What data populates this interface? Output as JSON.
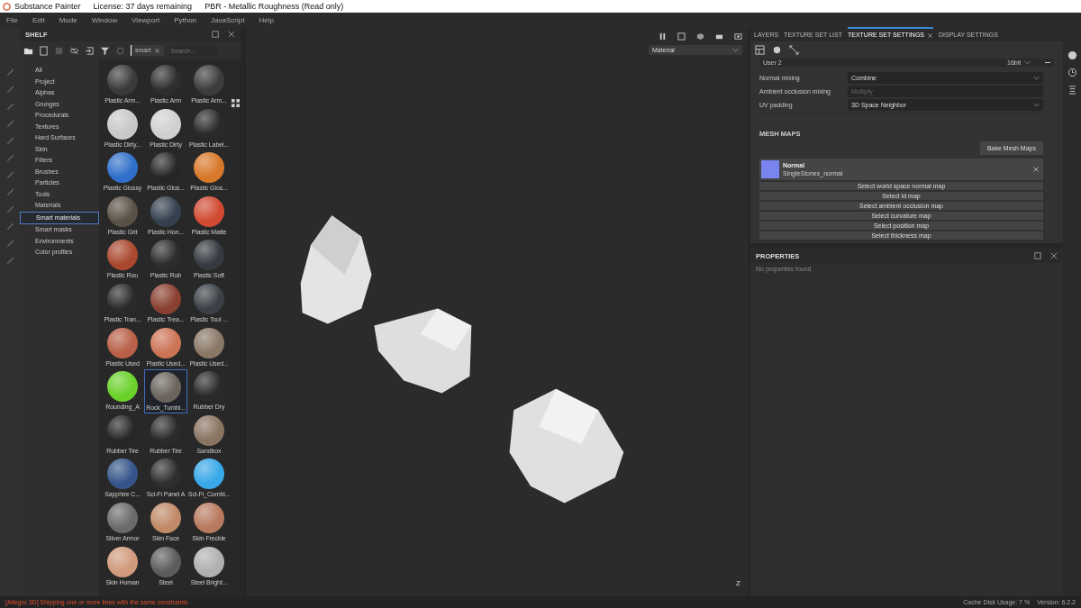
{
  "window": {
    "title": "Substance Painter",
    "license": "License: 37 days remaining",
    "mode": "PBR - Metallic Roughness (Read only)"
  },
  "menu": [
    "File",
    "Edit",
    "Mode",
    "Window",
    "Viewport",
    "Python",
    "JavaScript",
    "Help"
  ],
  "shelf": {
    "title": "SHELF",
    "filter_tag": "smart",
    "search": {
      "placeholder": "Search..."
    },
    "categories": [
      {
        "label": "All",
        "selected": false
      },
      {
        "label": "Project",
        "selected": false
      },
      {
        "label": "Alphas",
        "selected": false
      },
      {
        "label": "Grunges",
        "selected": false
      },
      {
        "label": "Procedurals",
        "selected": false
      },
      {
        "label": "Textures",
        "selected": false
      },
      {
        "label": "Hard Surfaces",
        "selected": false
      },
      {
        "label": "Skin",
        "selected": false
      },
      {
        "label": "Filters",
        "selected": false
      },
      {
        "label": "Brushes",
        "selected": false
      },
      {
        "label": "Particles",
        "selected": false
      },
      {
        "label": "Tools",
        "selected": false
      },
      {
        "label": "Materials",
        "selected": false
      },
      {
        "label": "Smart materials",
        "selected": true
      },
      {
        "label": "Smart masks",
        "selected": false
      },
      {
        "label": "Environments",
        "selected": false
      },
      {
        "label": "Color profiles",
        "selected": false
      }
    ],
    "materials": [
      {
        "name": "Plastic Arm...",
        "color": "#3a3a3a",
        "selected": false
      },
      {
        "name": "Plastic Arm",
        "color": "#2e2e2e",
        "selected": false
      },
      {
        "name": "Plastic Arm...",
        "color": "#3c3c3c",
        "selected": false
      },
      {
        "name": "Plastic Dirty...",
        "color": "#c8c8c8",
        "selected": false
      },
      {
        "name": "Plastic Dirty",
        "color": "#d0d0d0",
        "selected": false
      },
      {
        "name": "Plastic Label...",
        "color": "#2a2a2a",
        "selected": false
      },
      {
        "name": "Plastic Glossy",
        "color": "#2f6fc9",
        "selected": false
      },
      {
        "name": "Plastic Glos...",
        "color": "#262626",
        "selected": false
      },
      {
        "name": "Plastic Glos...",
        "color": "#d8782a",
        "selected": false
      },
      {
        "name": "Plastic Grit",
        "color": "#5a5146",
        "selected": false
      },
      {
        "name": "Plastic Hon...",
        "color": "#34404e",
        "selected": false
      },
      {
        "name": "Plastic Matte",
        "color": "#d24a32",
        "selected": false
      },
      {
        "name": "Plastic Rou",
        "color": "#a9482f",
        "selected": false
      },
      {
        "name": "Plastic Rub",
        "color": "#2c2c2c",
        "selected": false
      },
      {
        "name": "Plastic Soft",
        "color": "#343a40",
        "selected": false
      },
      {
        "name": "Plastic Tran...",
        "color": "#2a2a2a",
        "selected": false
      },
      {
        "name": "Plastic Trea...",
        "color": "#8a4030",
        "selected": false
      },
      {
        "name": "Plastic Tool ...",
        "color": "#3a4046",
        "selected": false
      },
      {
        "name": "Plastic Used",
        "color": "#b86048",
        "selected": false
      },
      {
        "name": "Plastic Used...",
        "color": "#cc7456",
        "selected": false
      },
      {
        "name": "Plastic Used...",
        "color": "#8a7866",
        "selected": false
      },
      {
        "name": "Rounding_A",
        "color": "#6ad12a",
        "selected": false
      },
      {
        "name": "Rock_Tumbl...",
        "color": "#6a645c",
        "selected": true
      },
      {
        "name": "Rubber Dry",
        "color": "#2a2a2a",
        "selected": false
      },
      {
        "name": "Rubber Tire",
        "color": "#262626",
        "selected": false
      },
      {
        "name": "Rubber Tire",
        "color": "#2a2a2a",
        "selected": false
      },
      {
        "name": "Sandbox",
        "color": "#8a7462",
        "selected": false
      },
      {
        "name": "Sapphire C...",
        "color": "#35558a",
        "selected": false
      },
      {
        "name": "Sci-Fi Panel A",
        "color": "#2e2e2e",
        "selected": false
      },
      {
        "name": "Sci-Fi_Combi...",
        "color": "#38a8e8",
        "selected": false
      },
      {
        "name": "Silver Armor",
        "color": "#6a6a6a",
        "selected": false
      },
      {
        "name": "Skin Face",
        "color": "#c08a68",
        "selected": false
      },
      {
        "name": "Skin Freckle",
        "color": "#b87a5e",
        "selected": false
      },
      {
        "name": "Skin Human",
        "color": "#d09a7c",
        "selected": false
      },
      {
        "name": "Steel",
        "color": "#5c5c5c",
        "selected": false
      },
      {
        "name": "Steel Bright...",
        "color": "#b0b0b0",
        "selected": false
      }
    ]
  },
  "viewport": {
    "display_mode": "Material",
    "axis_label": "Z"
  },
  "texture_panel": {
    "tabs": [
      {
        "label": "LAYERS",
        "selected": false
      },
      {
        "label": "TEXTURE SET LIST",
        "selected": false
      },
      {
        "label": "TEXTURE SET SETTINGS",
        "selected": true
      },
      {
        "label": "DISPLAY SETTINGS",
        "selected": false
      }
    ],
    "channel": {
      "name": "User 2",
      "format": "16bit"
    },
    "settings": [
      {
        "label": "Normal mixing",
        "value": "Combine",
        "disabled": false
      },
      {
        "label": "Ambient occlusion mixing",
        "value": "Multiply",
        "disabled": true
      },
      {
        "label": "UV padding",
        "value": "3D Space Neighbor",
        "disabled": false
      }
    ],
    "mesh_maps_title": "MESH MAPS",
    "bake_button": "Bake Mesh Maps",
    "normal_map": {
      "name": "Normal",
      "file": "SingleStones_normal"
    },
    "map_buttons": [
      "Select world space normal map",
      "Select id map",
      "Select ambient occlusion map",
      "Select curvature map",
      "Select position map",
      "Select thickness map"
    ]
  },
  "properties": {
    "title": "PROPERTIES",
    "message": "No properties found"
  },
  "status_bar": {
    "message": "[Allegro 3D] Shipping one or more lines with the same constraints",
    "cache": "Cache Disk Usage:  7 %",
    "version": "Version: 6.2.2"
  }
}
